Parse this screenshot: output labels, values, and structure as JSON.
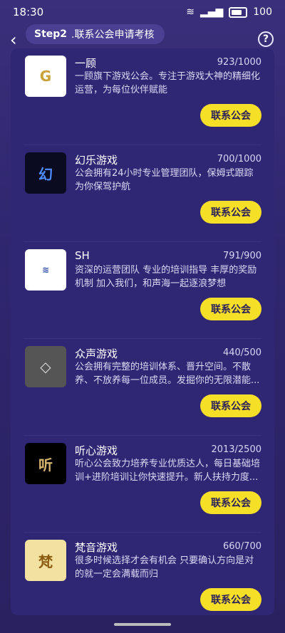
{
  "status_bar": {
    "time": "18:30",
    "battery": "100",
    "icons": [
      "wifi-icon",
      "signal-icon",
      "battery-icon"
    ]
  },
  "header": {
    "step": "Step2",
    "title": ".联系公会申请考核",
    "back_icon": "chevron-left-icon",
    "help_icon": "help-icon"
  },
  "guilds": [
    {
      "name": "一顾",
      "count": "923/1000",
      "desc": "一顾旗下游戏公会。专注于游戏大神的精细化运营，为每位伙伴赋能",
      "button": "联系公会"
    },
    {
      "name": "幻乐游戏",
      "count": "700/1000",
      "desc": "公会拥有24小时专业管理团队，保姆式跟踪为你保驾护航",
      "button": "联系公会"
    },
    {
      "name": "SH",
      "count": "791/900",
      "desc": "资深的运营团队 专业的培训指导 丰厚的奖励机制 加入我们，和声海一起逐浪梦想",
      "button": "联系公会"
    },
    {
      "name": "众声游戏",
      "count": "440/500",
      "desc": "公会拥有完整的培训体系、晋升空间。不散养、不放养每一位成员。发掘你的无限潜能...",
      "button": "联系公会"
    },
    {
      "name": "听心游戏",
      "count": "2013/2500",
      "desc": "听心公会致力培养专业优质达人，每日基础培训+进阶培训让你快速提升。新人扶持力度...",
      "button": "联系公会"
    },
    {
      "name": "梵音游戏",
      "count": "660/700",
      "desc": "很多时候选择才会有机会 只要确认方向是对的就一定会满载而归",
      "button": "联系公会"
    }
  ]
}
